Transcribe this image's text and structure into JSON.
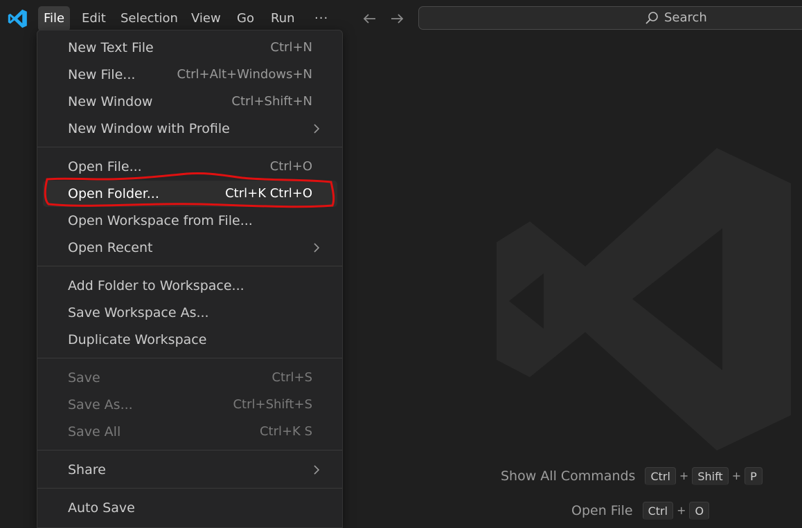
{
  "menubar": {
    "items": [
      "File",
      "Edit",
      "Selection",
      "View",
      "Go",
      "Run"
    ],
    "more": "···"
  },
  "command_center": {
    "placeholder": "Search"
  },
  "file_menu": {
    "groups": [
      [
        {
          "label": "New Text File",
          "key": "Ctrl+N"
        },
        {
          "label": "New File...",
          "key": "Ctrl+Alt+Windows+N"
        },
        {
          "label": "New Window",
          "key": "Ctrl+Shift+N"
        },
        {
          "label": "New Window with Profile",
          "submenu": true
        }
      ],
      [
        {
          "label": "Open File...",
          "key": "Ctrl+O"
        },
        {
          "label": "Open Folder...",
          "key": "Ctrl+K Ctrl+O",
          "highlighted": true
        },
        {
          "label": "Open Workspace from File..."
        },
        {
          "label": "Open Recent",
          "submenu": true
        }
      ],
      [
        {
          "label": "Add Folder to Workspace..."
        },
        {
          "label": "Save Workspace As..."
        },
        {
          "label": "Duplicate Workspace"
        }
      ],
      [
        {
          "label": "Save",
          "key": "Ctrl+S",
          "disabled": true
        },
        {
          "label": "Save As...",
          "key": "Ctrl+Shift+S",
          "disabled": true
        },
        {
          "label": "Save All",
          "key": "Ctrl+K S",
          "disabled": true
        }
      ],
      [
        {
          "label": "Share",
          "submenu": true
        }
      ],
      [
        {
          "label": "Auto Save"
        }
      ]
    ]
  },
  "shortcuts": {
    "show_all_commands": {
      "label": "Show All Commands",
      "keys": [
        "Ctrl",
        "Shift",
        "P"
      ]
    },
    "open_file": {
      "label": "Open File",
      "keys": [
        "Ctrl",
        "O"
      ]
    }
  },
  "colors": {
    "background": "#1f1f1f",
    "menu_bg": "#252526",
    "accent_logo": "#23a9f2",
    "annotation": "#e01010"
  }
}
